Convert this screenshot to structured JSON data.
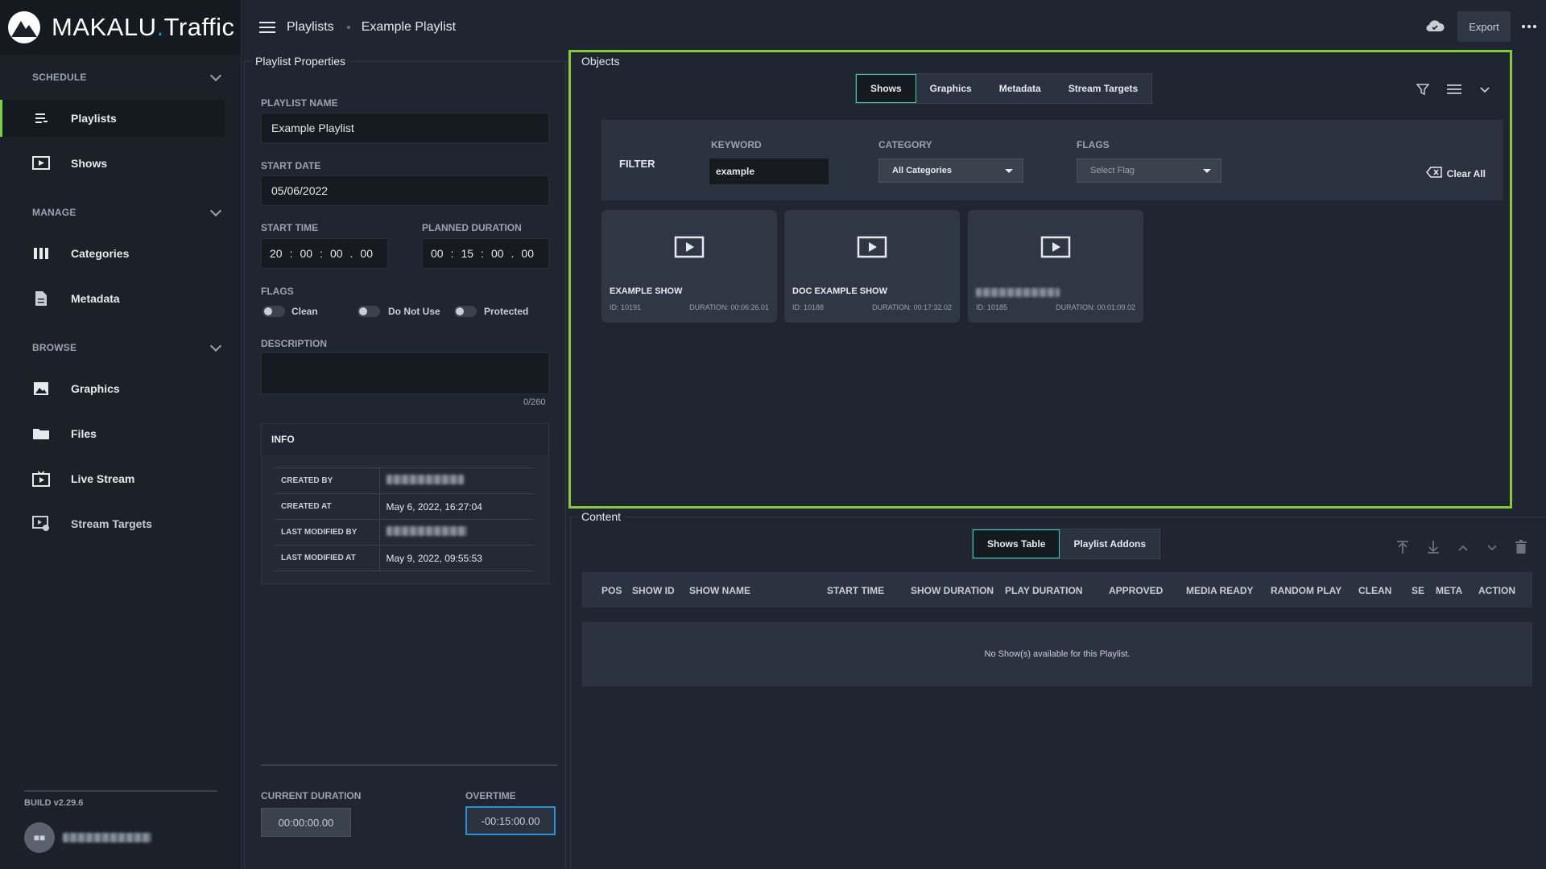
{
  "app": {
    "logo_main": "MAKALU",
    "logo_dot": ".",
    "logo_sub": "Traffic"
  },
  "breadcrumb": {
    "root": "Playlists",
    "current": "Example Playlist"
  },
  "topbar": {
    "export_label": "Export"
  },
  "sidebar": {
    "sections": [
      {
        "title": "SCHEDULE",
        "items": [
          "Playlists",
          "Shows"
        ]
      },
      {
        "title": "MANAGE",
        "items": [
          "Categories",
          "Metadata"
        ]
      },
      {
        "title": "BROWSE",
        "items": [
          "Graphics",
          "Files",
          "Live Stream",
          "Stream Targets"
        ]
      }
    ],
    "build": "BUILD v2.29.6",
    "avatar_initials": "■■"
  },
  "playlist_properties": {
    "panel_title": "Playlist Properties",
    "name_label": "PLAYLIST NAME",
    "name_value": "Example Playlist",
    "start_date_label": "START DATE",
    "start_date_value": "05/06/2022",
    "start_time_label": "START TIME",
    "start_time": [
      "20",
      "00",
      "00",
      "00"
    ],
    "planned_duration_label": "PLANNED DURATION",
    "planned_duration": [
      "00",
      "15",
      "00",
      "00"
    ],
    "flags_label": "FLAGS",
    "flags": [
      "Clean",
      "Do Not Use",
      "Protected"
    ],
    "description_label": "DESCRIPTION",
    "description_count": "0/260",
    "info": {
      "title": "INFO",
      "rows": [
        {
          "key": "CREATED BY",
          "value": ""
        },
        {
          "key": "CREATED AT",
          "value": "May 6, 2022, 16:27:04"
        },
        {
          "key": "LAST MODIFIED BY",
          "value": ""
        },
        {
          "key": "LAST MODIFIED AT",
          "value": "May 9, 2022, 09:55:53"
        }
      ]
    },
    "current_duration_label": "CURRENT DURATION",
    "current_duration_value": "00:00:00.00",
    "overtime_label": "OVERTIME",
    "overtime_value": "-00:15:00.00"
  },
  "objects": {
    "panel_title": "Objects",
    "tabs": [
      "Shows",
      "Graphics",
      "Metadata",
      "Stream Targets"
    ],
    "filter": {
      "title": "FILTER",
      "keyword_label": "KEYWORD",
      "keyword_value": "example",
      "category_label": "CATEGORY",
      "category_value": "All Categories",
      "flags_label": "FLAGS",
      "flags_placeholder": "Select Flag",
      "clear_all": "Clear All"
    },
    "cards": [
      {
        "title": "EXAMPLE SHOW",
        "id": "ID: 10191",
        "duration": "DURATION: 00:06:26.01"
      },
      {
        "title": "DOC EXAMPLE SHOW",
        "id": "ID: 10188",
        "duration": "DURATION: 00:17:32.02"
      },
      {
        "title": "",
        "id": "ID: 10185",
        "duration": "DURATION: 00:01:09.02"
      }
    ]
  },
  "content": {
    "panel_title": "Content",
    "tabs": [
      "Shows Table",
      "Playlist Addons"
    ],
    "columns": [
      "POS",
      "SHOW ID",
      "SHOW NAME",
      "START TIME",
      "SHOW DURATION",
      "PLAY DURATION",
      "APPROVED",
      "MEDIA READY",
      "RANDOM PLAY",
      "CLEAN",
      "SE",
      "META",
      "ACTION"
    ],
    "empty_message": "No Show(s) available for this Playlist."
  }
}
